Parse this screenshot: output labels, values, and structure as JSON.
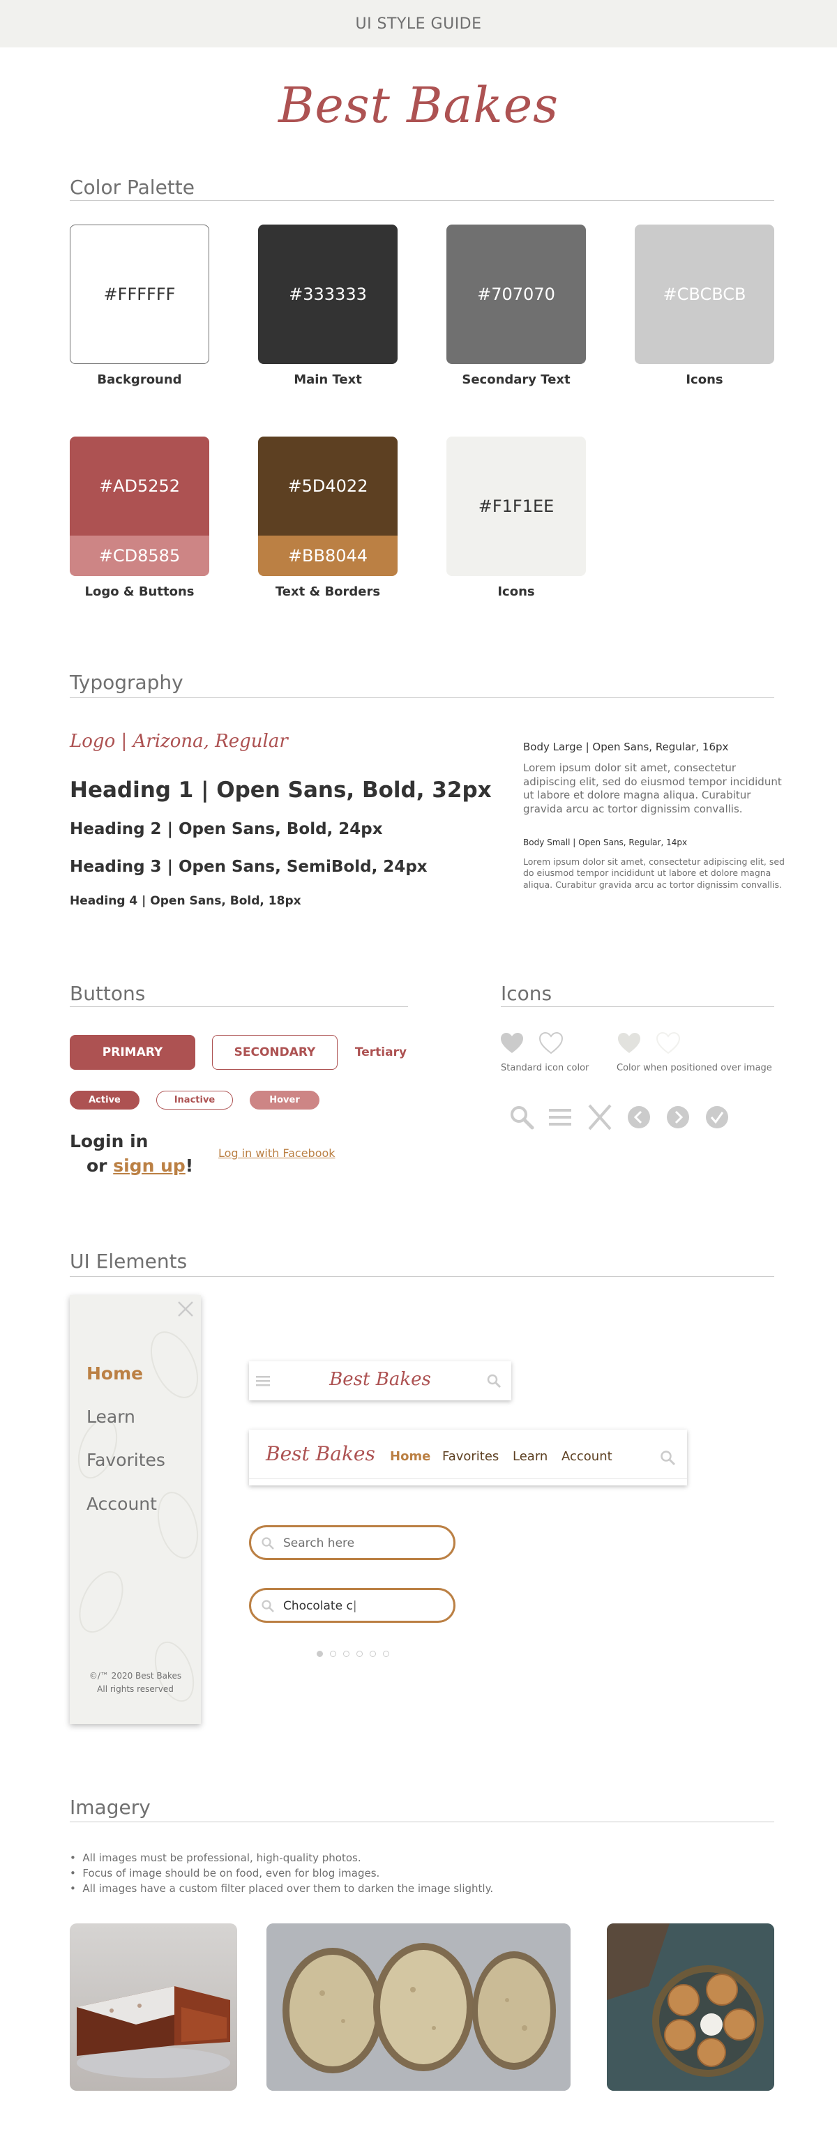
{
  "header": {
    "title": "UI STYLE GUIDE"
  },
  "brand": {
    "logo_text": "Best Bakes"
  },
  "sections": {
    "color_palette": "Color Palette",
    "typography": "Typography",
    "buttons": "Buttons",
    "icons": "Icons",
    "ui_elements": "UI Elements",
    "imagery": "Imagery"
  },
  "palette": {
    "row1": [
      {
        "hex": "#FFFFFF",
        "label": "Background"
      },
      {
        "hex": "#333333",
        "label": "Main Text"
      },
      {
        "hex": "#707070",
        "label": "Secondary Text"
      },
      {
        "hex": "#CBCBCB",
        "label": "Icons"
      }
    ],
    "row2": [
      {
        "hex": "#AD5252",
        "hex2": "#CD8585",
        "label": "Logo & Buttons"
      },
      {
        "hex": "#5D4022",
        "hex2": "#BB8044",
        "label": "Text & Borders"
      },
      {
        "hex": "#F1F1EE",
        "label": "Icons"
      }
    ]
  },
  "typography": {
    "logo_sample": "Logo | Arizona, Regular",
    "h1": "Heading 1 | Open Sans, Bold, 32px",
    "h2": "Heading 2 | Open Sans, Bold, 24px",
    "h3": "Heading 3 | Open Sans, SemiBold, 24px",
    "h4": "Heading 4 | Open Sans, Bold, 18px",
    "body_large_label": "Body Large | Open Sans, Regular, 16px",
    "body_large_text": "Lorem ipsum dolor sit amet, consectetur adipiscing elit, sed do eiusmod tempor incididunt ut labore et dolore magna aliqua. Curabitur gravida arcu ac tortor dignissim convallis.",
    "body_small_label": "Body Small | Open Sans, Regular, 14px",
    "body_small_text": "Lorem ipsum dolor sit amet, consectetur adipiscing elit, sed do eiusmod tempor incididunt ut labore et dolore magna aliqua. Curabitur gravida arcu ac tortor dignissim convallis."
  },
  "buttons": {
    "primary": "PRIMARY",
    "secondary": "SECONDARY",
    "tertiary": "Tertiary",
    "active": "Active",
    "inactive": "Inactive",
    "hover": "Hover",
    "login_prefix": "Login in",
    "login_or": "or",
    "sign_up": "sign up",
    "exclamation": "!",
    "facebook": "Log in with Facebook"
  },
  "icons": {
    "standard_caption": "Standard icon color",
    "over_image_caption": "Color when positioned over image"
  },
  "ui": {
    "sidebar_items": [
      "Home",
      "Learn",
      "Favorites",
      "Account"
    ],
    "footer_line1": "©/™ 2020 Best Bakes",
    "footer_line2": "All rights reserved",
    "nav_items": [
      "Home",
      "Favorites",
      "Learn",
      "Account"
    ],
    "search_placeholder": "Search here",
    "search_value": "Chocolate c"
  },
  "imagery": {
    "bullets": [
      "All images must be professional, high-quality photos.",
      "Focus of image should be on food, even for blog images.",
      "All images have a custom filter placed over them to darken the image slightly."
    ]
  }
}
